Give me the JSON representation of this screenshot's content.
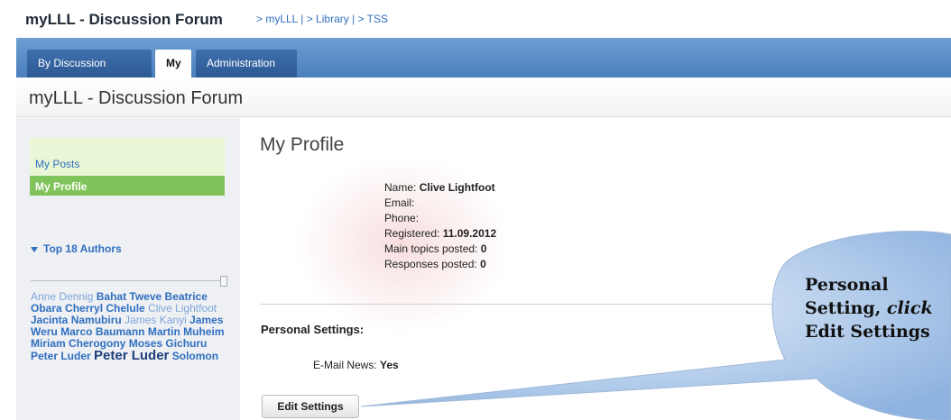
{
  "header": {
    "app_title": "myLLL - Discussion Forum",
    "breadcrumb": [
      "> myLLL",
      "| > Library",
      "| > TSS"
    ]
  },
  "tabs": [
    {
      "label": "By Discussion",
      "active": false
    },
    {
      "label": "My",
      "active": true
    },
    {
      "label": "Administration",
      "active": false
    }
  ],
  "subheader": {
    "title": "myLLL - Discussion Forum"
  },
  "sidebar": {
    "menu": [
      {
        "label": "My Posts",
        "active": false
      },
      {
        "label": "My Profile",
        "active": true
      }
    ],
    "authors_heading": "Top 18 Authors",
    "authors": [
      {
        "text": "Anne Dennig",
        "weight": "light"
      },
      {
        "text": "Bahat Tweve",
        "weight": "medium"
      },
      {
        "text": "Beatrice Obara",
        "weight": "medium"
      },
      {
        "text": "Cherryl Chelule",
        "weight": "medium"
      },
      {
        "text": "Clive Lightfoot",
        "weight": "light"
      },
      {
        "text": "Jacinta Namubiru",
        "weight": "medium"
      },
      {
        "text": "James Kanyi",
        "weight": "light"
      },
      {
        "text": "James Weru",
        "weight": "medium"
      },
      {
        "text": "Marco Baumann",
        "weight": "medium"
      },
      {
        "text": "Martin Muheim",
        "weight": "medium"
      },
      {
        "text": "Miriam Cherogony",
        "weight": "medium"
      },
      {
        "text": "Moses Gichuru",
        "weight": "medium"
      },
      {
        "text": "Peter Luder",
        "weight": "medium"
      },
      {
        "text": "Peter Luder",
        "weight": "heavy"
      },
      {
        "text": "Solomon",
        "weight": "medium"
      }
    ]
  },
  "profile": {
    "title": "My Profile",
    "name_label": "Name:",
    "name_value": "Clive Lightfoot",
    "email_label": "Email:",
    "phone_label": "Phone:",
    "registered_label": "Registered:",
    "registered_value": "11.09.2012",
    "main_topics_label": "Main topics posted:",
    "main_topics_value": "0",
    "responses_label": "Responses posted:",
    "responses_value": "0"
  },
  "settings": {
    "heading": "Personal Settings:",
    "email_news_label": "E-Mail News:",
    "email_news_value": "Yes",
    "edit_button": "Edit Settings"
  },
  "callout": {
    "line1": "Personal",
    "line2_a": "Setting,",
    "line2_b": "click",
    "line3": "Edit Settings"
  },
  "colors": {
    "tabbar": "#4a7fbd",
    "active_menu": "#80c35a",
    "link": "#2f6fbf",
    "callout_fill": "#8fb3e0"
  }
}
